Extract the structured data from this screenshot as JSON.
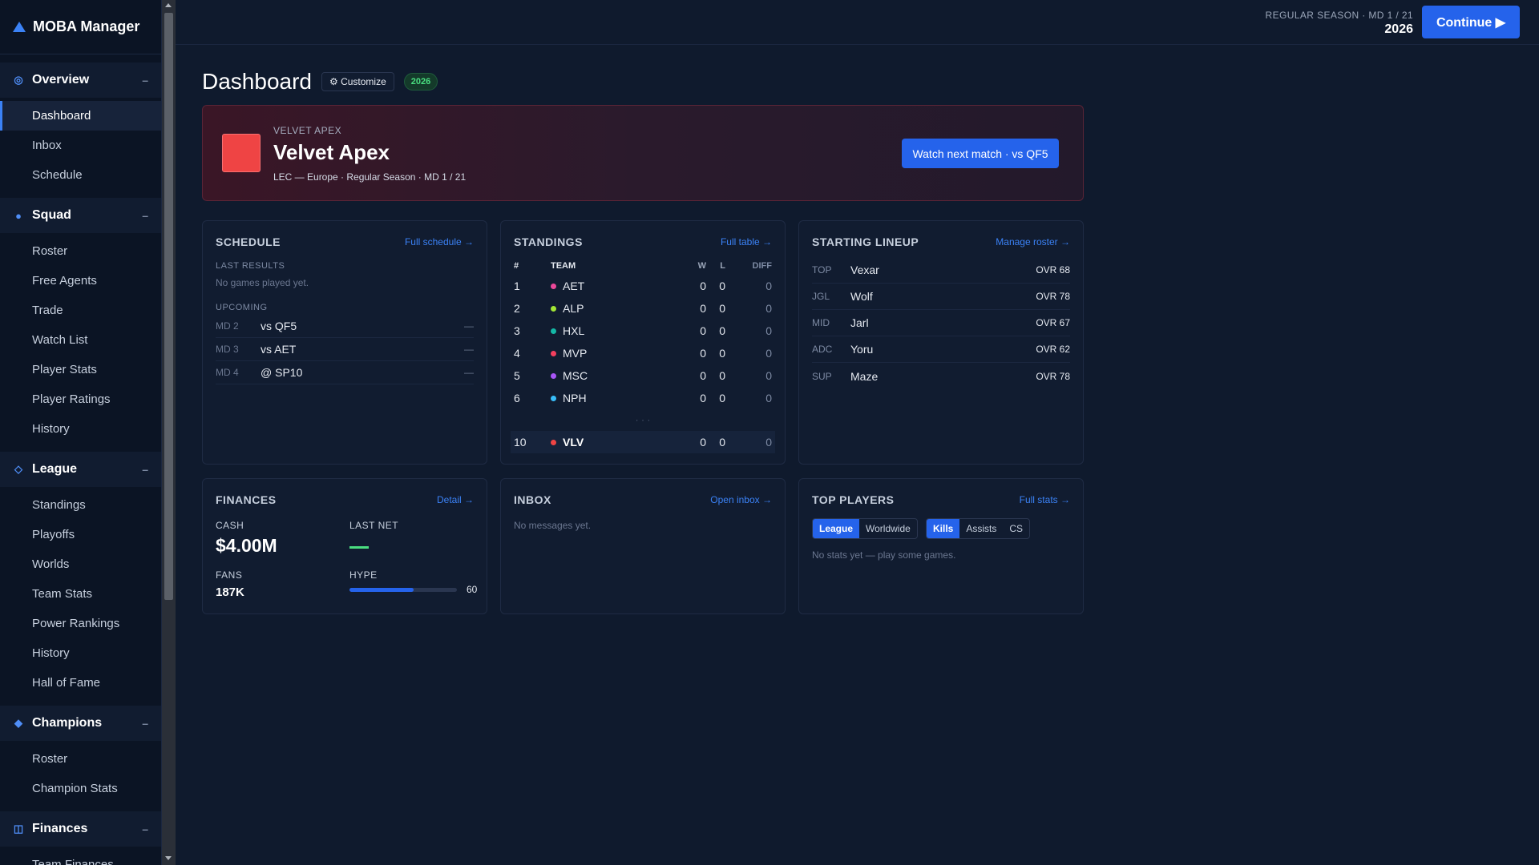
{
  "app": {
    "title": "MOBA Manager"
  },
  "sidebar": {
    "sections": [
      {
        "label": "Overview",
        "icon": "circle-target-icon",
        "items": [
          "Dashboard",
          "Inbox",
          "Schedule"
        ]
      },
      {
        "label": "Squad",
        "icon": "circle-dot-icon",
        "items": [
          "Roster",
          "Free Agents",
          "Trade",
          "Watch List",
          "Player Stats",
          "Player Ratings",
          "History"
        ]
      },
      {
        "label": "League",
        "icon": "diamond-outline-icon",
        "items": [
          "Standings",
          "Playoffs",
          "Worlds",
          "Team Stats",
          "Power Rankings",
          "History",
          "Hall of Fame"
        ]
      },
      {
        "label": "Champions",
        "icon": "diamond-filled-icon",
        "items": [
          "Roster",
          "Champion Stats"
        ]
      },
      {
        "label": "Finances",
        "icon": "square-grid-icon",
        "items": [
          "Team Finances"
        ]
      }
    ],
    "collapse_glyph": "–",
    "active_item": "Dashboard"
  },
  "topbar": {
    "season_label": "REGULAR SEASON · MD 1 / 21",
    "year": "2026",
    "continue_label": "Continue ▶"
  },
  "page": {
    "title": "Dashboard",
    "customize_label": "⚙ Customize",
    "year_badge": "2026"
  },
  "hero": {
    "team_sub": "VELVET APEX",
    "team_name": "Velvet Apex",
    "meta": "LEC — Europe · Regular Season · MD 1 / 21",
    "watch_label": "Watch next match · vs QF5",
    "team_color": "#ef4444"
  },
  "schedule": {
    "title": "SCHEDULE",
    "link": "Full schedule →",
    "last_results_label": "LAST RESULTS",
    "no_games": "No games played yet.",
    "upcoming_label": "UPCOMING",
    "upcoming": [
      {
        "md": "MD 2",
        "opponent": "vs QF5",
        "result": "—"
      },
      {
        "md": "MD 3",
        "opponent": "vs AET",
        "result": "—"
      },
      {
        "md": "MD 4",
        "opponent": "@ SP10",
        "result": "—"
      }
    ]
  },
  "standings": {
    "title": "STANDINGS",
    "link": "Full table →",
    "headers": {
      "rank": "#",
      "team": "TEAM",
      "w": "W",
      "l": "L",
      "diff": "DIFF"
    },
    "rows": [
      {
        "rank": "1",
        "team": "AET",
        "color": "#ec4899",
        "w": "0",
        "l": "0",
        "diff": "0"
      },
      {
        "rank": "2",
        "team": "ALP",
        "color": "#a3e635",
        "w": "0",
        "l": "0",
        "diff": "0"
      },
      {
        "rank": "3",
        "team": "HXL",
        "color": "#14b8a6",
        "w": "0",
        "l": "0",
        "diff": "0"
      },
      {
        "rank": "4",
        "team": "MVP",
        "color": "#f43f5e",
        "w": "0",
        "l": "0",
        "diff": "0"
      },
      {
        "rank": "5",
        "team": "MSC",
        "color": "#a855f7",
        "w": "0",
        "l": "0",
        "diff": "0"
      },
      {
        "rank": "6",
        "team": "NPH",
        "color": "#38bdf8",
        "w": "0",
        "l": "0",
        "diff": "0"
      }
    ],
    "ellipsis": "· · ·",
    "my_row": {
      "rank": "10",
      "team": "VLV",
      "color": "#ef4444",
      "w": "0",
      "l": "0",
      "diff": "0"
    }
  },
  "lineup": {
    "title": "STARTING LINEUP",
    "link": "Manage roster →",
    "players": [
      {
        "pos": "TOP",
        "name": "Vexar",
        "ovr": "OVR 68"
      },
      {
        "pos": "JGL",
        "name": "Wolf",
        "ovr": "OVR 78"
      },
      {
        "pos": "MID",
        "name": "Jarl",
        "ovr": "OVR 67"
      },
      {
        "pos": "ADC",
        "name": "Yoru",
        "ovr": "OVR 62"
      },
      {
        "pos": "SUP",
        "name": "Maze",
        "ovr": "OVR 78"
      }
    ]
  },
  "finances": {
    "title": "FINANCES",
    "link": "Detail →",
    "cash_label": "CASH",
    "cash": "$4.00M",
    "last_net_label": "LAST NET",
    "fans_label": "FANS",
    "fans": "187K",
    "hype_label": "HYPE",
    "hype": "60",
    "hype_fraction": 0.6
  },
  "inbox": {
    "title": "INBOX",
    "link": "Open inbox →",
    "empty": "No messages yet."
  },
  "top_players": {
    "title": "TOP PLAYERS",
    "link": "Full stats →",
    "scope_tabs": [
      "League",
      "Worldwide"
    ],
    "scope_active": "League",
    "stat_tabs": [
      "Kills",
      "Assists",
      "CS"
    ],
    "stat_active": "Kills",
    "empty": "No stats yet — play some games."
  }
}
